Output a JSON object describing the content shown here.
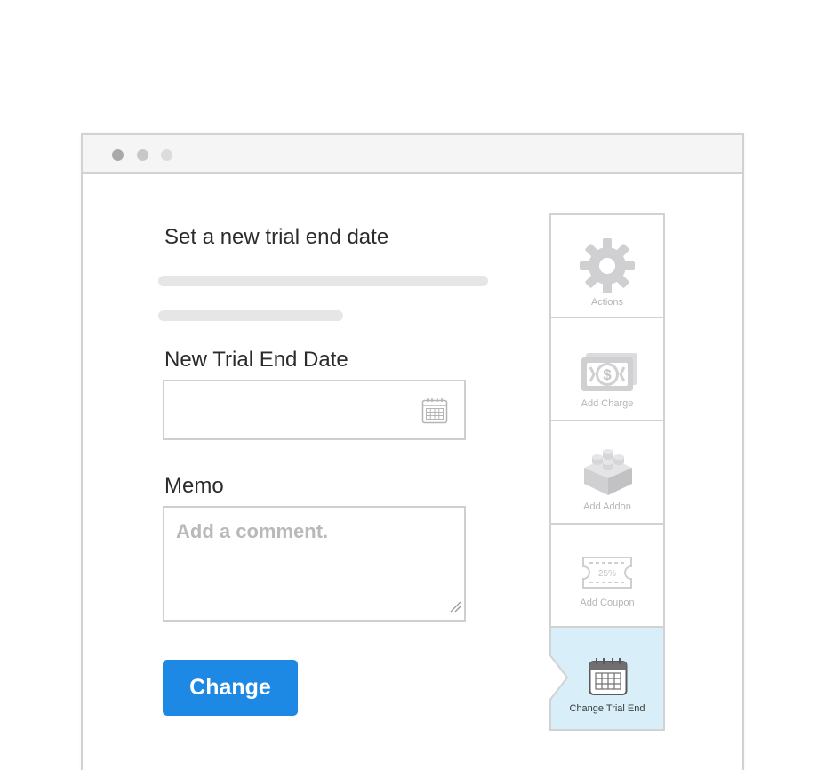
{
  "window": {
    "controls": [
      "window-dot-1",
      "window-dot-2",
      "window-dot-3"
    ]
  },
  "form": {
    "heading": "Set a new trial end date",
    "date_label": "New Trial End Date",
    "date_value": "",
    "memo_label": "Memo",
    "memo_placeholder": "Add a comment.",
    "submit_label": "Change"
  },
  "action_panel": {
    "items": [
      {
        "label": "Actions",
        "icon": "gear-icon"
      },
      {
        "label": "Add Charge",
        "icon": "money-icon"
      },
      {
        "label": "Add Addon",
        "icon": "lego-brick-icon"
      },
      {
        "label": "Add Coupon",
        "icon": "coupon-icon",
        "icon_text": "25%"
      },
      {
        "label": "Change Trial End",
        "icon": "calendar-icon",
        "active": true
      }
    ]
  },
  "colors": {
    "accent": "#1e88e5",
    "active_panel_bg": "#d8eef9",
    "border": "#d2d2d2",
    "icon_gray": "#d0d0d2"
  }
}
